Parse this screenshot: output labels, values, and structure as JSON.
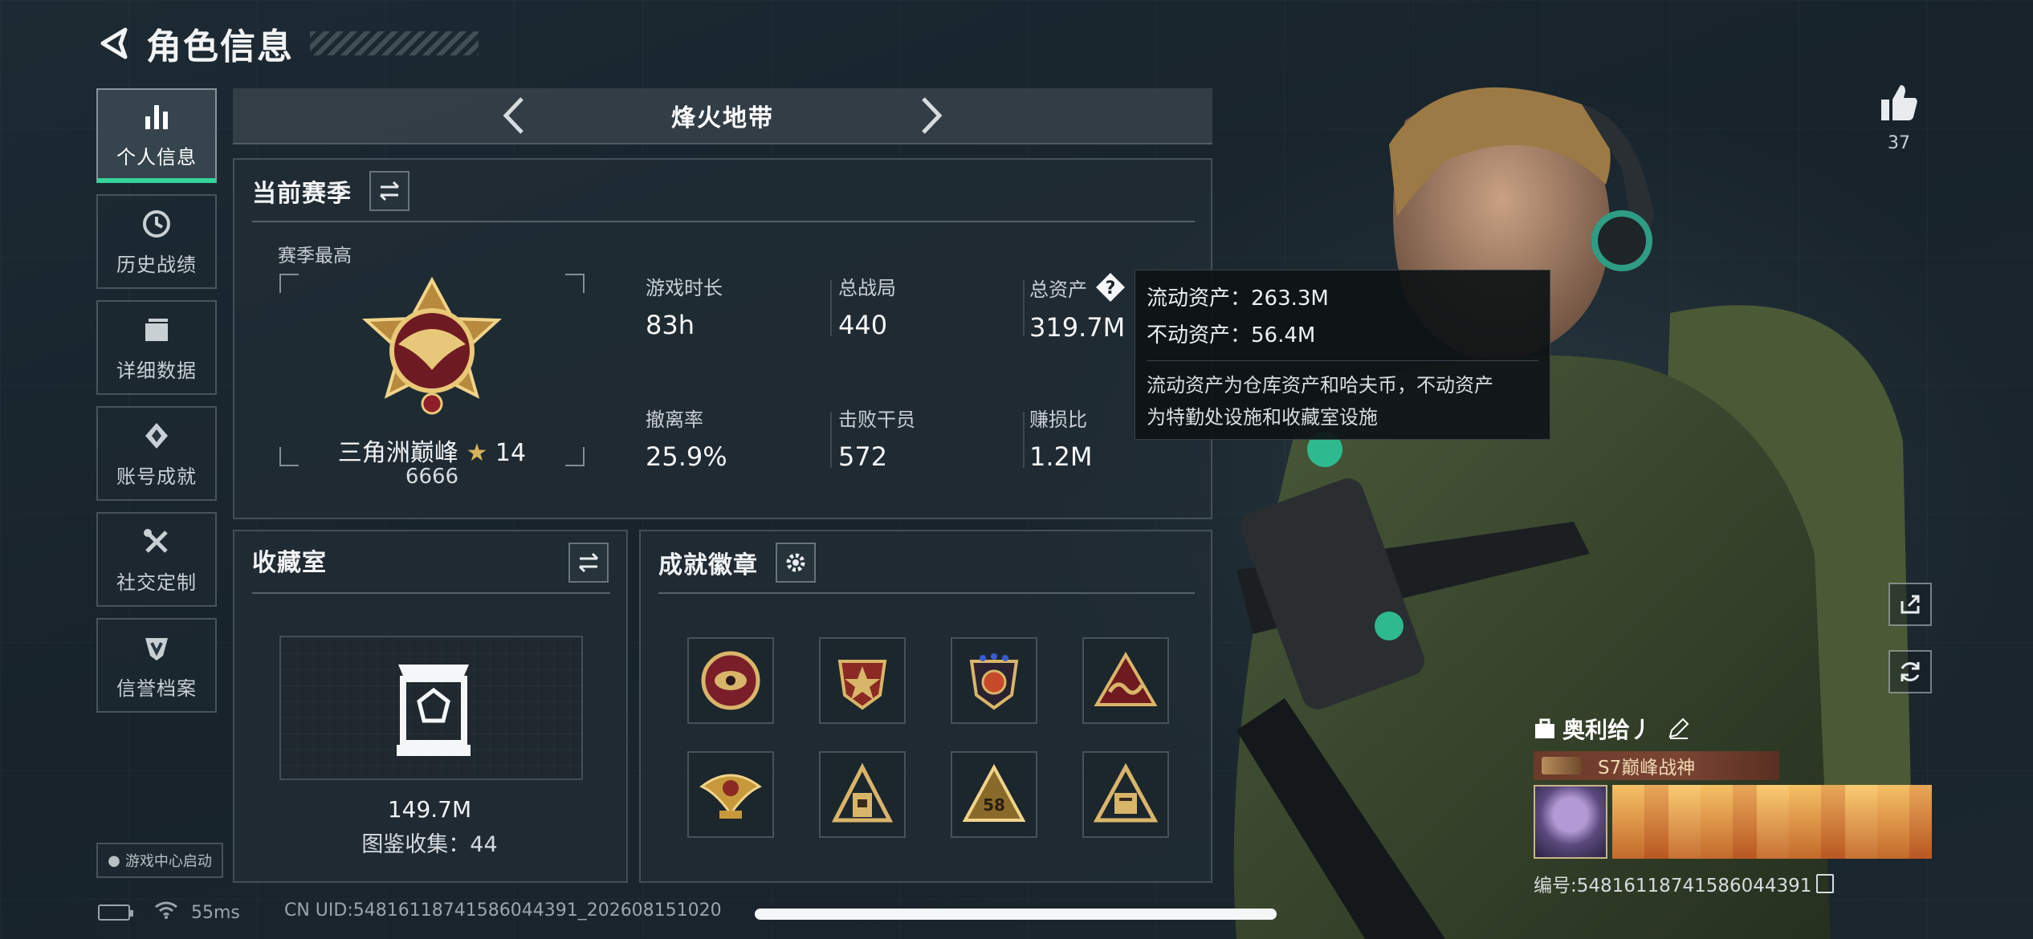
{
  "header": {
    "title": "角色信息"
  },
  "sidebar": {
    "items": [
      {
        "label": "个人信息",
        "icon": "bar-chart-icon",
        "active": true
      },
      {
        "label": "历史战绩",
        "icon": "clock-icon"
      },
      {
        "label": "详细数据",
        "icon": "folder-icon"
      },
      {
        "label": "账号成就",
        "icon": "achievement-icon"
      },
      {
        "label": "社交定制",
        "icon": "tools-icon"
      },
      {
        "label": "信誉档案",
        "icon": "shield-icon"
      }
    ],
    "launch_label": "游戏中心启动"
  },
  "mode": {
    "title": "烽火地带"
  },
  "season": {
    "title": "当前赛季",
    "subtitle": "赛季最高",
    "rank_name": "三角洲巅峰",
    "rank_star": "★",
    "rank_level": "14",
    "rank_score": "6666",
    "stats": [
      {
        "label": "游戏时长",
        "value": "83h"
      },
      {
        "label": "总战局",
        "value": "440"
      },
      {
        "label": "总资产",
        "value": "319.7M"
      },
      {
        "label": "撤离率",
        "value": "25.9%"
      },
      {
        "label": "击败干员",
        "value": "572"
      },
      {
        "label": "赚损比",
        "value": "1.2M"
      }
    ]
  },
  "tooltip": {
    "liquid": "流动资产：263.3M",
    "fixed": "不动资产：56.4M",
    "desc_1": "流动资产为仓库资产和哈夫币，不动资产",
    "desc_2": "为特勤处设施和收藏室设施"
  },
  "collection": {
    "title": "收藏室",
    "value": "149.7M",
    "count": "图鉴收集：44"
  },
  "badges": {
    "title": "成就徽章",
    "items": [
      "badge-eye",
      "badge-star-shield",
      "badge-star-crest",
      "badge-triangle-wave",
      "badge-eagle",
      "badge-tower",
      "badge-triangle-58",
      "badge-triangle-box"
    ]
  },
  "likes": {
    "count": "37"
  },
  "player": {
    "name": "奥利给丿",
    "title": "S7巅峰战神",
    "id": "编号:54816118741586044391"
  },
  "status": {
    "ping": "55ms",
    "uid": "CN UID:54816118741586044391_202608151020"
  },
  "colors": {
    "accent": "#34d49a",
    "gold": "#d8b35a"
  }
}
